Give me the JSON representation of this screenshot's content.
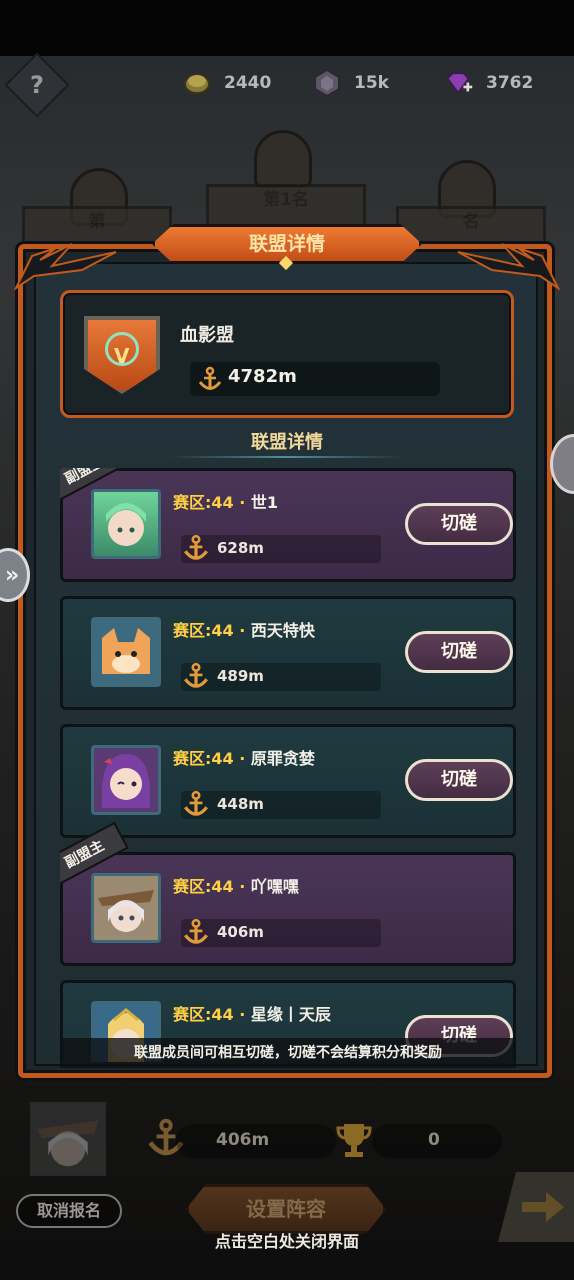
{
  "resources": {
    "gold": "2440",
    "crystal": "15k",
    "gems": "3762"
  },
  "podium": {
    "center_label": "第1名",
    "left_label": "第",
    "right_label": "名"
  },
  "modal": {
    "title": "联盟详情",
    "guild": {
      "name": "血影盟",
      "distance": "4782m"
    },
    "section_title": "联盟详情",
    "members": [
      {
        "server": "赛区:44",
        "name": "世1",
        "distance": "628m",
        "deputy": true,
        "action": "切磋",
        "role_tag": "副盟主"
      },
      {
        "server": "赛区:44",
        "name": "西天特快",
        "distance": "489m",
        "deputy": false,
        "action": "切磋"
      },
      {
        "server": "赛区:44",
        "name": "原罪贪婪",
        "distance": "448m",
        "deputy": false,
        "action": "切磋"
      },
      {
        "server": "赛区:44",
        "name": "吖嘿嘿",
        "distance": "406m",
        "deputy": true,
        "action": "切磋",
        "role_tag": "副盟主"
      },
      {
        "server": "赛区:44",
        "name": "星缘丨天辰",
        "distance": "",
        "deputy": false,
        "action": "切磋"
      }
    ],
    "hint": "联盟成员间可相互切磋，切磋不会结算积分和奖励"
  },
  "bottom": {
    "distance": "406m",
    "trophy": "0",
    "cancel_label": "取消报名",
    "setup_label": "设置阵容",
    "close_hint": "点击空白处关闭界面"
  },
  "colors": {
    "accent_orange": "#c25a1d",
    "gold_text": "#ffcf45",
    "deputy_row": "#4a3556",
    "normal_row": "#1f3a40"
  }
}
